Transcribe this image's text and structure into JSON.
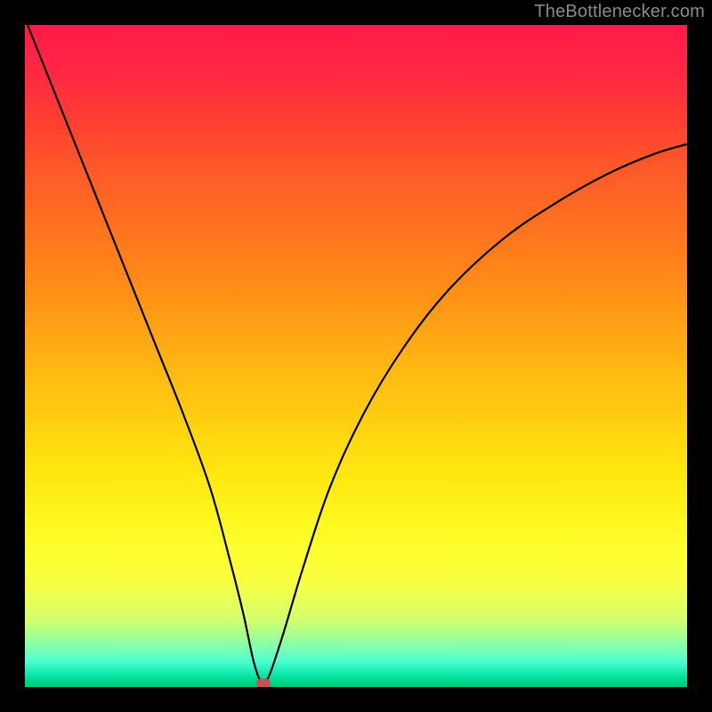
{
  "watermark": "TheBottlenecker.com",
  "chart_data": {
    "type": "line",
    "title": "",
    "xlabel": "",
    "ylabel": "",
    "xlim": [
      0,
      100
    ],
    "ylim": [
      0,
      100
    ],
    "series": [
      {
        "name": "bottleneck-curve",
        "x": [
          0,
          4,
          8,
          12,
          16,
          20,
          24,
          28,
          31,
          33,
          34.5,
          35.5,
          36,
          37,
          39,
          42,
          46,
          51,
          57,
          64,
          72,
          80,
          88,
          95,
          100
        ],
        "y": [
          101,
          91,
          81,
          71,
          61,
          51,
          41,
          30,
          19,
          11,
          4,
          1,
          0.5,
          2,
          8,
          18,
          30,
          41,
          51,
          60,
          67.5,
          73,
          77.5,
          80.5,
          82
        ]
      }
    ],
    "marker": {
      "x": 36,
      "y": 0.5,
      "color": "#c5524e"
    },
    "background_gradient": {
      "stops": [
        {
          "pos": 0,
          "color": "#ff1a4a"
        },
        {
          "pos": 50,
          "color": "#ffc010"
        },
        {
          "pos": 80,
          "color": "#ffff30"
        },
        {
          "pos": 100,
          "color": "#00c878"
        }
      ]
    }
  }
}
